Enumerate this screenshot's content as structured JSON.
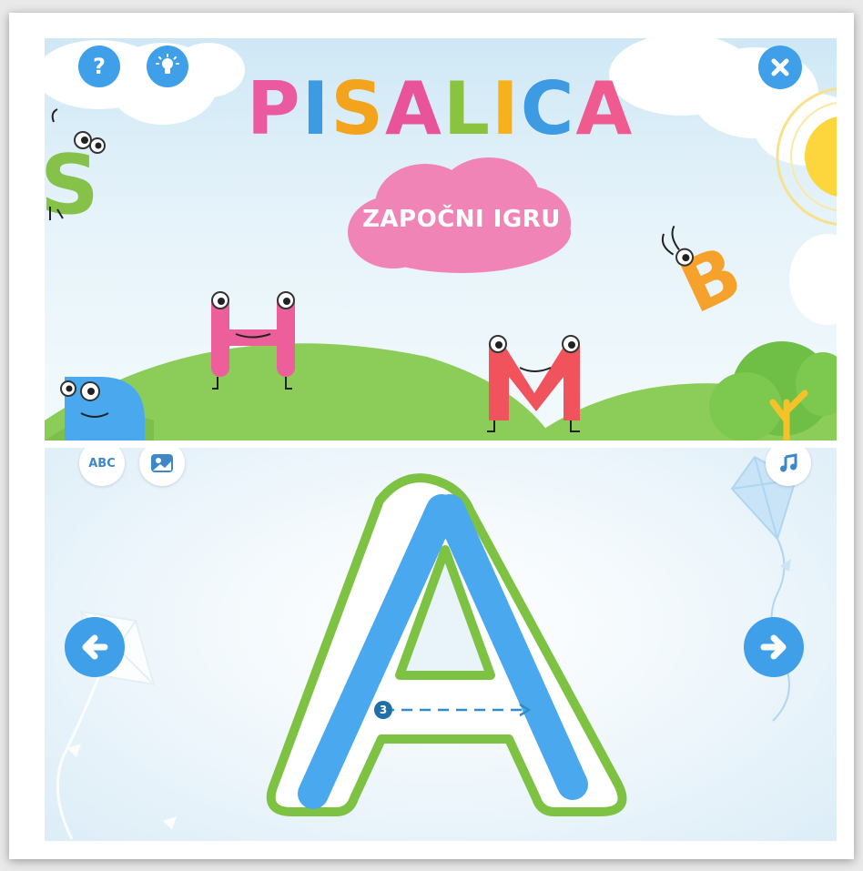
{
  "title": {
    "letters": [
      "P",
      "I",
      "S",
      "A",
      "L",
      "I",
      "C",
      "A"
    ],
    "letter_colors": [
      "#eb5aa0",
      "#3c9be2",
      "#f4a31d",
      "#e9539a",
      "#8ac43f",
      "#f6b21a",
      "#3c9be2",
      "#ef5a8f"
    ]
  },
  "top_bar": {
    "help_icon": "question-mark",
    "hint_icon": "lightbulb",
    "close_icon": "close-x"
  },
  "start_button": {
    "label": "ZAPOČNI IGRU",
    "color": "#f084b6"
  },
  "characters": {
    "s": "S",
    "h": "H",
    "m": "M",
    "b": "B",
    "d": "D"
  },
  "tracing": {
    "letter": "A",
    "stroke_number": "3",
    "outline_color": "#7dc242",
    "fill_color": "#4aa8ef"
  },
  "toolbar": {
    "abc_label": "ABC",
    "picture_icon": "picture-mode",
    "music_icon": "music-note",
    "prev_icon": "arrow-left",
    "next_icon": "arrow-right"
  },
  "colors": {
    "accent_blue": "#3f9fe8",
    "grass_green": "#8ccd5a",
    "sun_yellow": "#fcd63c"
  }
}
